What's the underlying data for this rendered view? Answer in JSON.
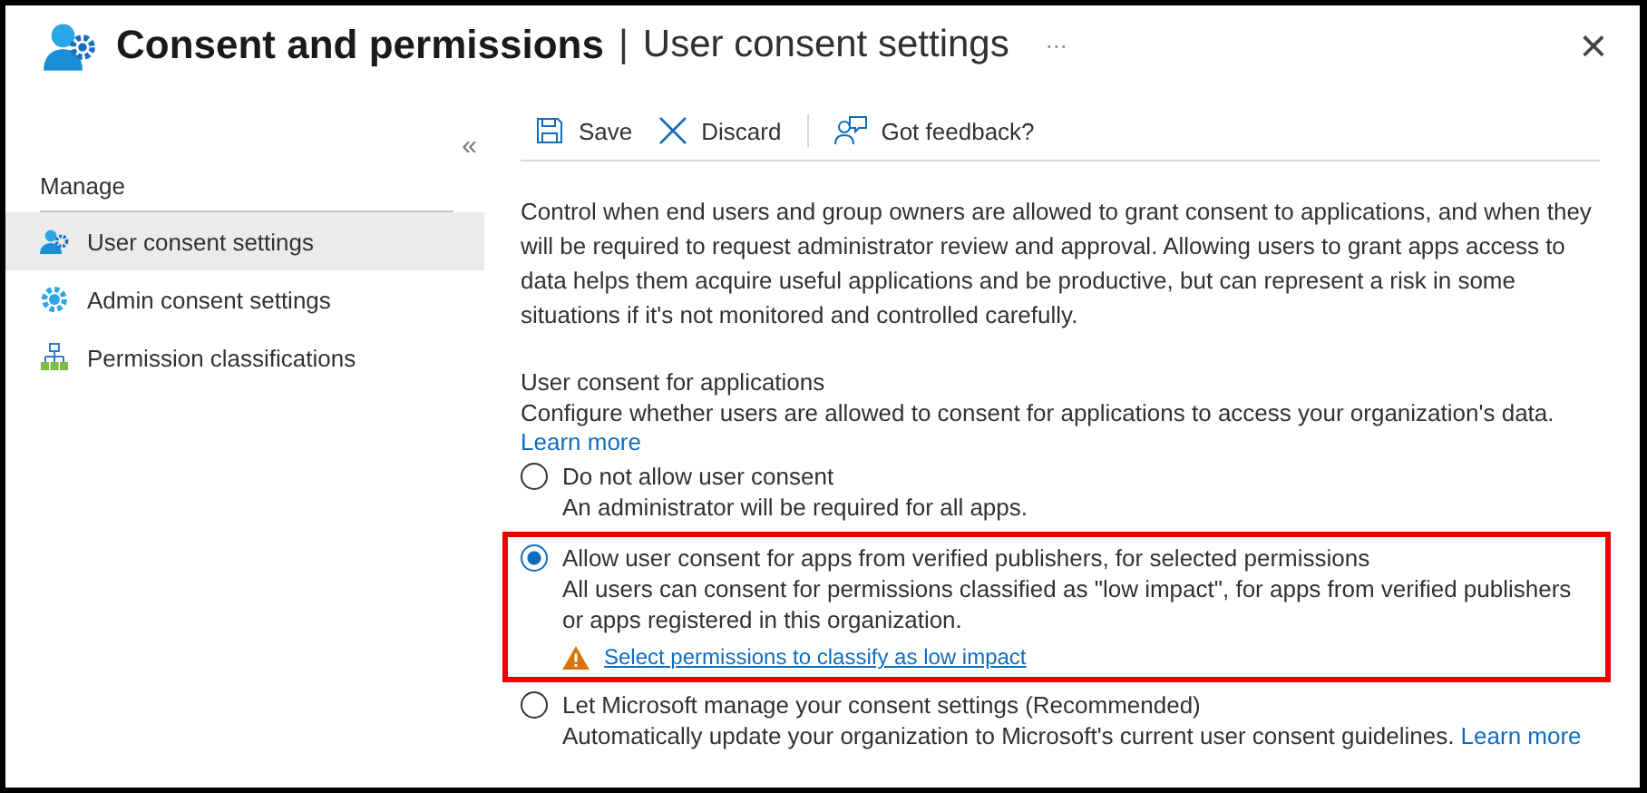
{
  "window": {
    "title": "Consent and permissions",
    "separator": "|",
    "subtitle": "User consent settings",
    "more": "···",
    "close": "×"
  },
  "sidebar": {
    "collapse": "«",
    "section": "Manage",
    "items": [
      {
        "label": "User consent settings",
        "kind": "user-gear",
        "selected": true
      },
      {
        "label": "Admin consent settings",
        "kind": "gear",
        "selected": false
      },
      {
        "label": "Permission classifications",
        "kind": "hierarchy",
        "selected": false
      }
    ]
  },
  "toolbar": [
    {
      "label": "Save",
      "kind": "save"
    },
    {
      "label": "Discard",
      "kind": "discard"
    },
    {
      "label": "Got feedback?",
      "kind": "feedback"
    }
  ],
  "description": "Control when end users and group owners are allowed to grant consent to applications, and when they will be required to request administrator review and approval. Allowing users to grant apps access to data helps them acquire useful applications and be productive, but can represent a risk in some situations if it's not monitored and controlled carefully.",
  "section": {
    "title": "User consent for applications",
    "text": "Configure whether users are allowed to consent for applications to access your organization's data.",
    "link": "Learn more"
  },
  "options": [
    {
      "label": "Do not allow user consent",
      "description": "An administrator will be required for all apps.",
      "selected": false,
      "highlighted": false
    },
    {
      "label": "Allow user consent for apps from verified publishers, for selected permissions",
      "description": "All users can consent for permissions classified as \"low impact\", for apps from verified publishers or apps registered in this organization.",
      "selected": true,
      "highlighted": true,
      "warning_link": "Select permissions to classify as low impact"
    },
    {
      "label": "Let Microsoft manage your consent settings (Recommended)",
      "description": "Automatically update your organization to Microsoft's current user consent guidelines.",
      "link": "Learn more",
      "selected": false,
      "highlighted": false
    }
  ]
}
